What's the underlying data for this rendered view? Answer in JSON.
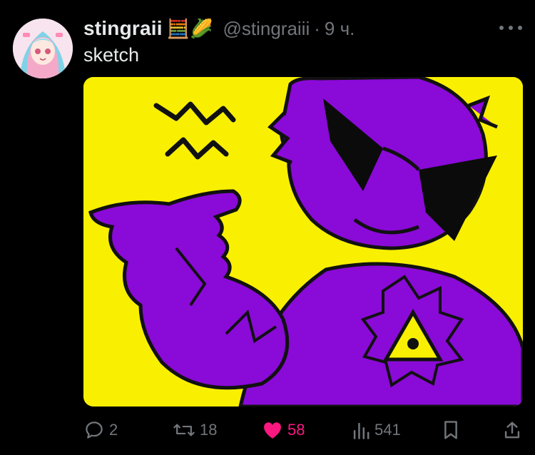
{
  "post": {
    "display_name": "stingraii",
    "name_emojis": "🧮🌽",
    "handle": "@stingraiii",
    "separator": "·",
    "time": "9 ч.",
    "text": "sketch"
  },
  "actions": {
    "replies": "2",
    "reposts": "18",
    "likes": "58",
    "views": "541"
  },
  "colors": {
    "like": "#f91880",
    "muted": "#71767b",
    "text": "#e7e9ea",
    "art_background": "#f8f000",
    "art_character": "#8a0ad8"
  },
  "icons": {
    "more": "more-horizontal-icon",
    "reply": "reply-icon",
    "repost": "repost-icon",
    "like": "heart-icon",
    "views": "views-icon",
    "bookmark": "bookmark-icon",
    "share": "share-icon"
  }
}
